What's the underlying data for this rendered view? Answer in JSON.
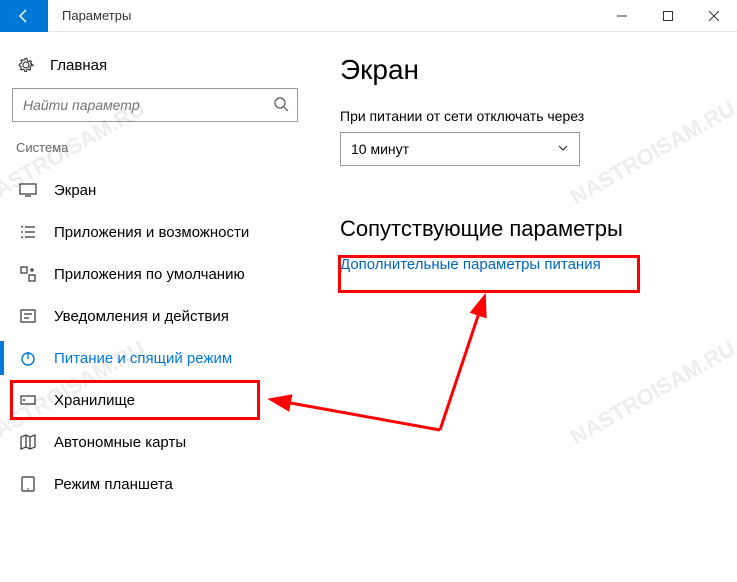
{
  "titlebar": {
    "title": "Параметры"
  },
  "sidebar": {
    "home": "Главная",
    "search_placeholder": "Найти параметр",
    "category": "Система",
    "items": [
      {
        "label": "Экран"
      },
      {
        "label": "Приложения и возможности"
      },
      {
        "label": "Приложения по умолчанию"
      },
      {
        "label": "Уведомления и действия"
      },
      {
        "label": "Питание и спящий режим"
      },
      {
        "label": "Хранилище"
      },
      {
        "label": "Автономные карты"
      },
      {
        "label": "Режим планшета"
      }
    ]
  },
  "main": {
    "heading": "Экран",
    "dropdown_label": "При питании от сети отключать через",
    "dropdown_value": "10 минут",
    "related_heading": "Сопутствующие параметры",
    "related_link": "Дополнительные параметры питания"
  },
  "watermark": "NASTROISAM.RU"
}
